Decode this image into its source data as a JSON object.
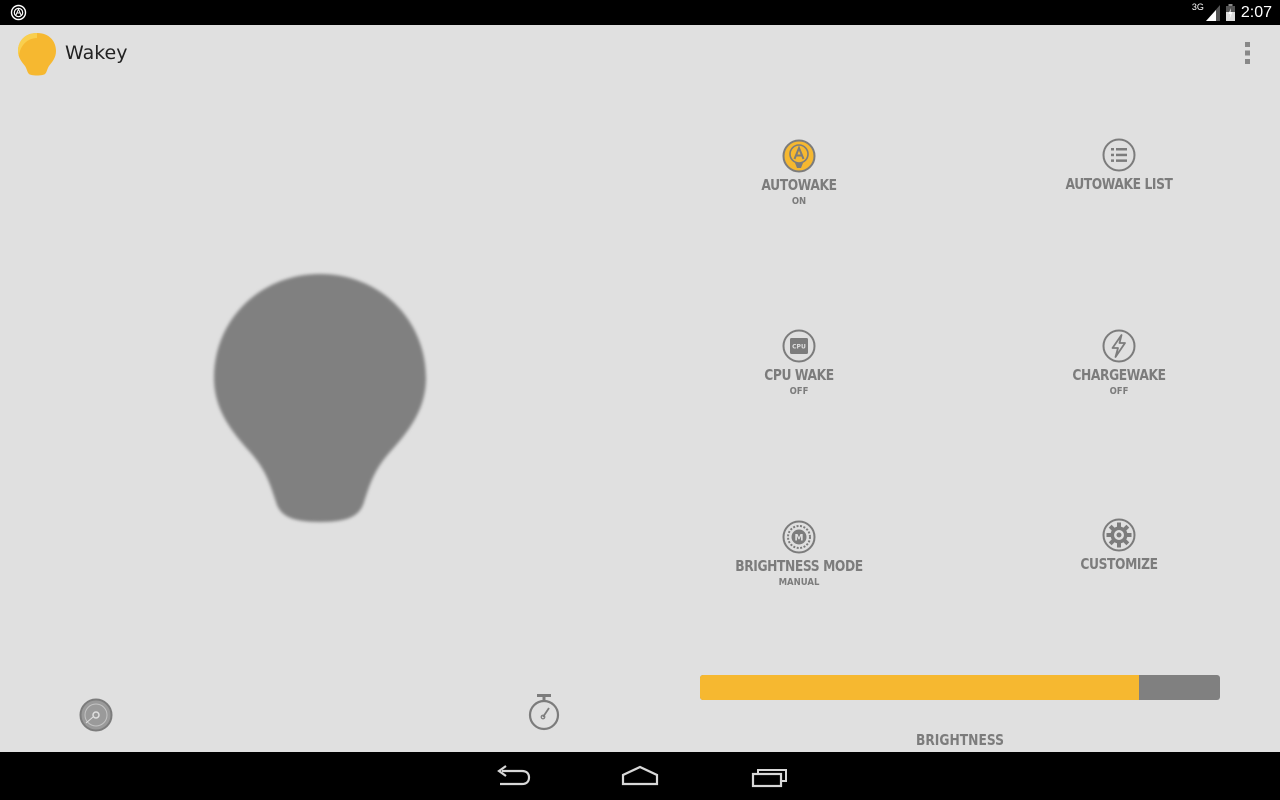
{
  "status_bar": {
    "network": "3G",
    "time": "2:07"
  },
  "app": {
    "title": "Wakey"
  },
  "controls": {
    "autowake": {
      "label": "AUTOWAKE",
      "state": "ON"
    },
    "autowake_list": {
      "label": "AUTOWAKE LIST"
    },
    "cpu_wake": {
      "label": "CPU WAKE",
      "state": "OFF",
      "chip_text": "CPU"
    },
    "chargewake": {
      "label": "CHARGEWAKE",
      "state": "OFF"
    },
    "brightness_mode": {
      "label": "BRIGHTNESS MODE",
      "state": "MANUAL",
      "badge": "M"
    },
    "customize": {
      "label": "CUSTOMIZE"
    }
  },
  "brightness": {
    "label": "BRIGHTNESS",
    "level": 0.845
  },
  "colors": {
    "accent": "#f6b830",
    "icon_gray": "#7c7c7c",
    "bulb_gray": "#808080",
    "background": "#e0e0e0"
  },
  "icons": {
    "status_left": "android-notification-icon",
    "app_logo": "lightbulb-icon",
    "overflow": "overflow-menu-icon",
    "bottom_left": "disc-icon",
    "bottom_right": "stopwatch-icon",
    "nav": [
      "back-icon",
      "home-icon",
      "recents-icon"
    ]
  }
}
